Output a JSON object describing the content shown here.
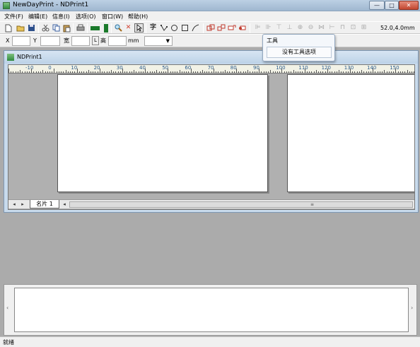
{
  "window": {
    "title": "NewDayPrint - NDPrint1",
    "min": "—",
    "max": "□",
    "close": "✕"
  },
  "menu": [
    "文件(F)",
    "编辑(E)",
    "信息(I)",
    "选项(O)",
    "窗口(W)",
    "帮助(H)"
  ],
  "toolbar": {
    "coord_readout": "52.0,4.0mm",
    "text_tool_glyph": "字"
  },
  "props": {
    "x_label": "X",
    "y_label": "Y",
    "width_label": "宽",
    "height_label": "高",
    "lock_label": "L",
    "unit_label": "mm",
    "unit_dropdown": "▼"
  },
  "document": {
    "title": "NDPrint1",
    "ruler_numbers": [
      "-10",
      "0",
      "10",
      "20",
      "30",
      "40",
      "50",
      "60",
      "70",
      "80",
      "90",
      "100",
      "110",
      "120",
      "130",
      "140",
      "150"
    ],
    "tab_label": "名片 1"
  },
  "popup": {
    "header": "工具",
    "item": "没有工具选项"
  },
  "status": {
    "text": "就绪"
  },
  "icons": {
    "new": "new-file-icon",
    "open": "open-folder-icon",
    "save": "save-icon",
    "cut": "cut-icon",
    "copy": "copy-icon",
    "paste": "paste-icon",
    "print": "print-icon",
    "zoom": "zoom-icon",
    "delete": "delete-x-icon",
    "select": "select-arrow-icon",
    "text": "text-tool-icon",
    "node": "node-tool-icon",
    "ellipse": "ellipse-tool-icon",
    "rect": "rect-tool-icon",
    "line": "line-tool-icon"
  },
  "colors": {
    "accent_green": "#2f8a3f",
    "delete_red": "#d23b2a",
    "ruler_blue": "#2a5b8c"
  }
}
